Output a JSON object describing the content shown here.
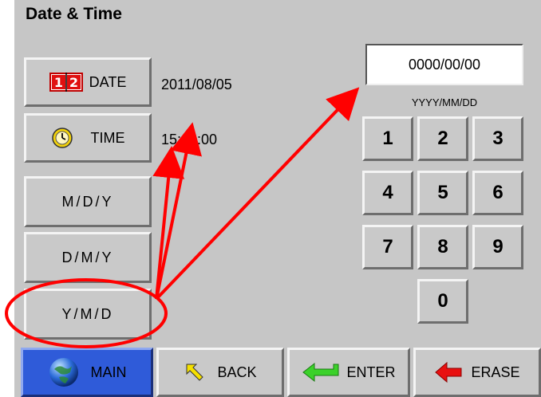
{
  "title": "Date & Time",
  "left_buttons": {
    "date_label": "DATE",
    "date_icon_text": "12",
    "time_label": "TIME",
    "mdy_label": "M/D/Y",
    "dmy_label": "D/M/Y",
    "ymd_label": "Y/M/D"
  },
  "values": {
    "date": "2011/08/05",
    "time": "15:48:00"
  },
  "entry": {
    "value": "0000/00/00",
    "format_hint": "YYYY/MM/DD"
  },
  "keypad": [
    "1",
    "2",
    "3",
    "4",
    "5",
    "6",
    "7",
    "8",
    "9",
    "0"
  ],
  "bottom_bar": {
    "main_label": "MAIN",
    "back_label": "BACK",
    "enter_label": "ENTER",
    "erase_label": "ERASE"
  },
  "colors": {
    "panel": "#c6c6c6",
    "annotation": "#ff0000",
    "main_button": "#2f5bd9"
  },
  "icons": {
    "date": "calendar-icon",
    "time": "clock-icon",
    "main": "globe-icon",
    "back": "back-arrow-icon",
    "enter": "enter-arrow-icon",
    "erase": "erase-arrow-icon"
  }
}
